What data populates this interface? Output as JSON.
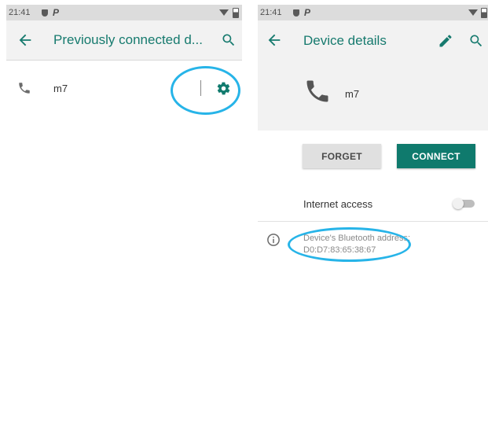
{
  "left_screen": {
    "status_bar": {
      "time": "21:41",
      "icons": [
        "shield-icon",
        "p-icon",
        "wifi-icon",
        "battery-icon"
      ]
    },
    "app_bar": {
      "title": "Previously connected d...",
      "back_icon": "arrow-back-icon",
      "search_icon": "search-icon"
    },
    "device_row": {
      "icon": "phone-icon",
      "name": "m7",
      "settings_icon": "gear-icon"
    }
  },
  "right_screen": {
    "status_bar": {
      "time": "21:41",
      "icons": [
        "shield-icon",
        "p-icon",
        "wifi-icon",
        "battery-icon"
      ]
    },
    "app_bar": {
      "title": "Device details",
      "back_icon": "arrow-back-icon",
      "edit_icon": "pencil-icon",
      "search_icon": "search-icon"
    },
    "device_header": {
      "icon": "phone-icon",
      "name": "m7"
    },
    "buttons": {
      "forget_label": "FORGET",
      "connect_label": "CONNECT"
    },
    "internet_access": {
      "label": "Internet access",
      "enabled": false
    },
    "bluetooth_address": {
      "line1": "Device's Bluetooth address:",
      "line2": "D0:D7:83:65:38:67"
    }
  },
  "annotations": {
    "highlight_color": "#27b4e8"
  },
  "colors": {
    "accent": "#167a6e",
    "connect_button": "#0f7a6d"
  }
}
